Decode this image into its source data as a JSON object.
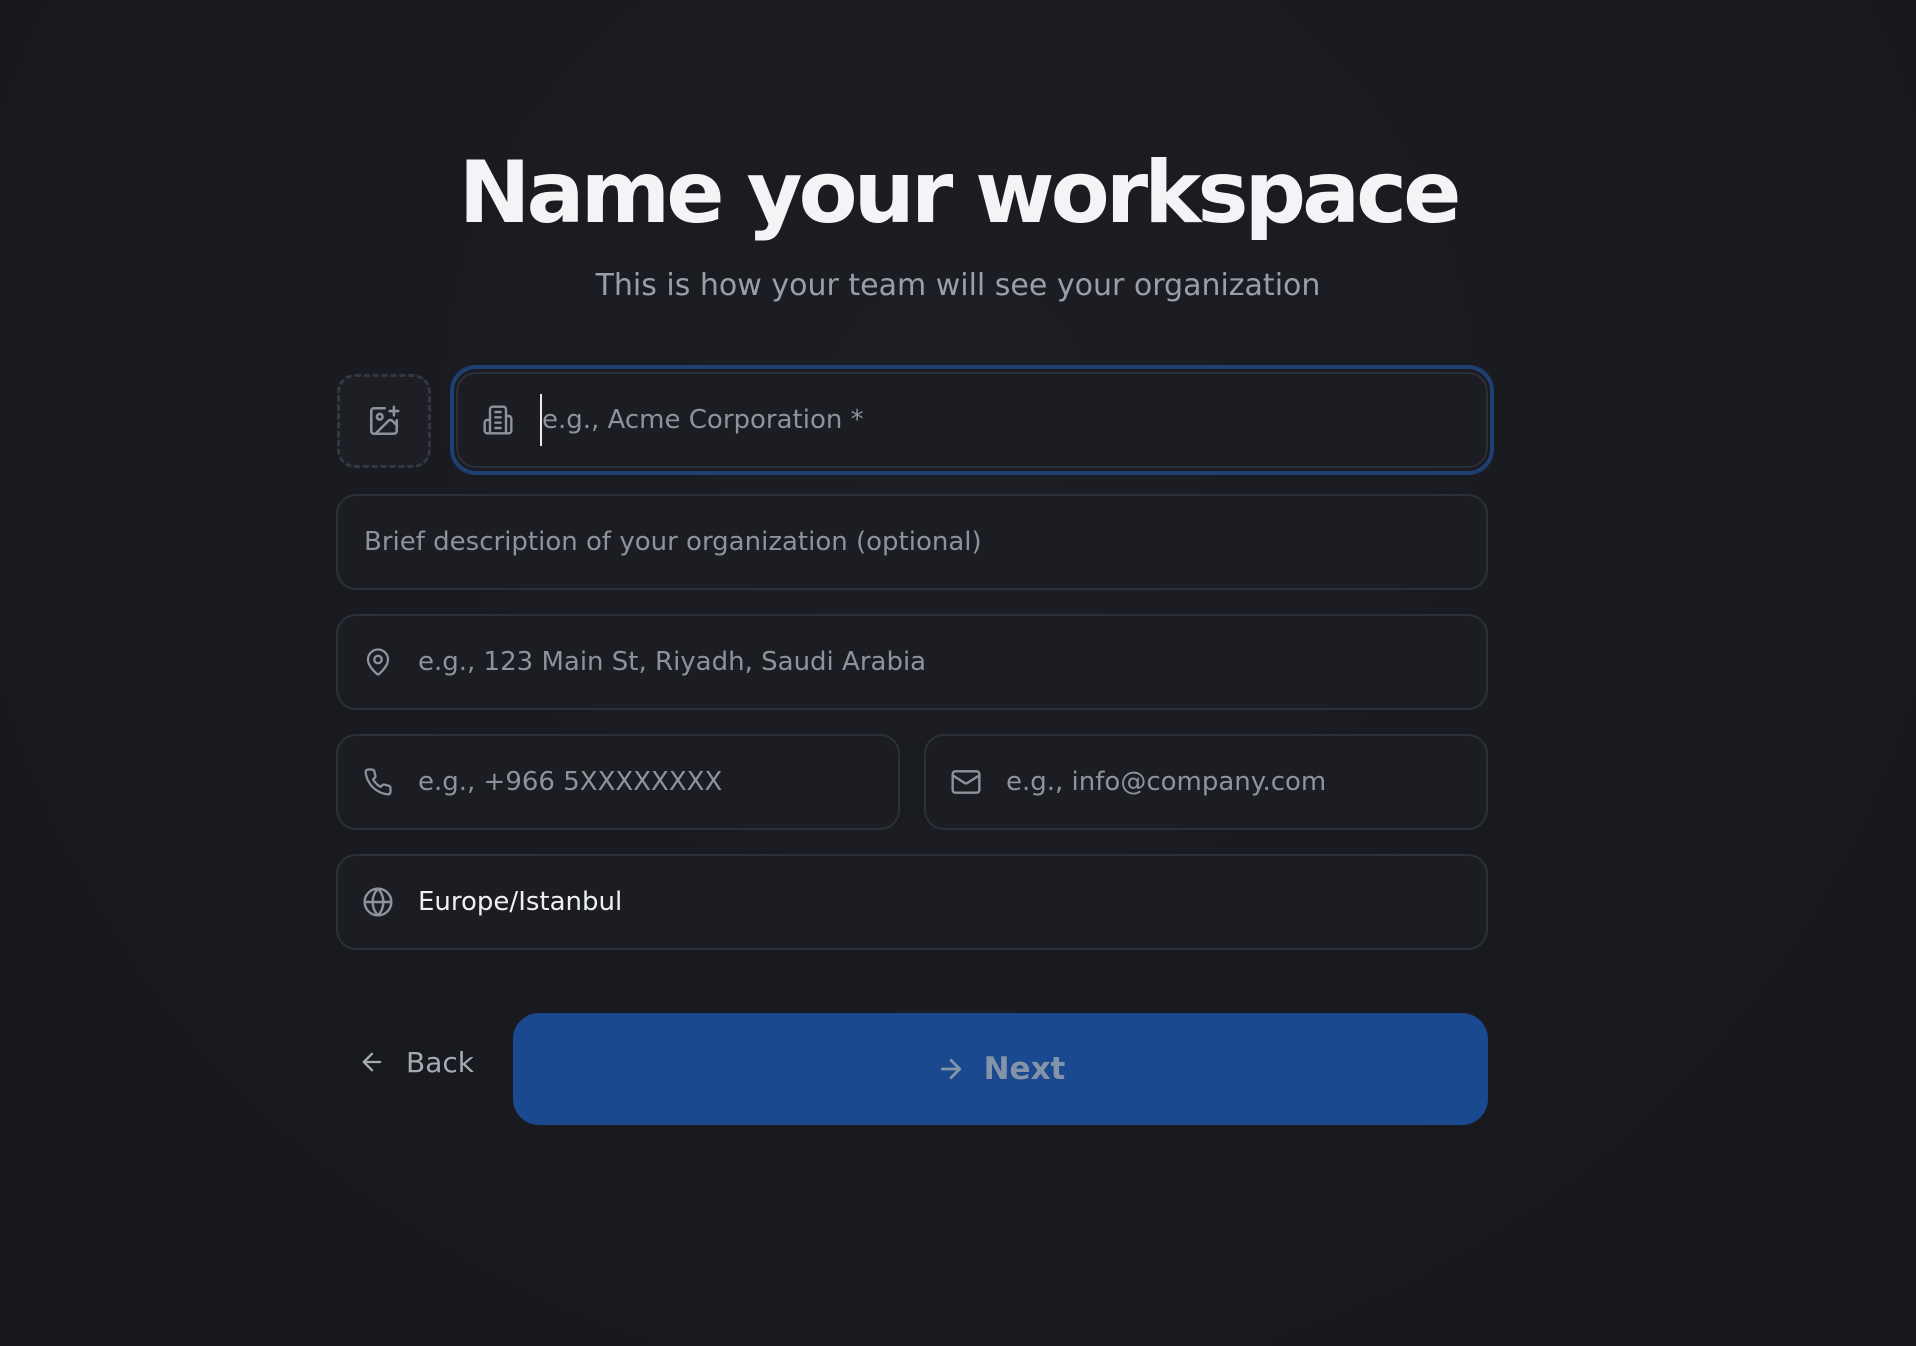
{
  "header": {
    "title": "Name your workspace",
    "subtitle": "This is how your team will see your organization"
  },
  "form": {
    "logo_upload": {
      "icon": "image-plus-icon"
    },
    "org_name": {
      "icon": "building-icon",
      "placeholder": "e.g., Acme Corporation *",
      "value": ""
    },
    "description": {
      "placeholder": "Brief description of your organization (optional)",
      "value": ""
    },
    "address": {
      "icon": "map-pin-icon",
      "placeholder": "e.g., 123 Main St, Riyadh, Saudi Arabia",
      "value": ""
    },
    "phone": {
      "icon": "phone-icon",
      "placeholder": "e.g., +966 5XXXXXXXX",
      "value": ""
    },
    "email": {
      "icon": "mail-icon",
      "placeholder": "e.g., info@company.com",
      "value": ""
    },
    "timezone": {
      "icon": "globe-icon",
      "value": "Europe/Istanbul"
    }
  },
  "actions": {
    "back_label": "Back",
    "back_icon": "arrow-left-icon",
    "next_label": "Next",
    "next_icon": "arrow-right-icon"
  },
  "colors": {
    "background": "#17191e",
    "field_background": "#1b1d22",
    "field_border": "#2d3038",
    "focus_ring": "#1f3e72",
    "primary_button": "#1a4990",
    "placeholder_text": "#8e929c"
  }
}
